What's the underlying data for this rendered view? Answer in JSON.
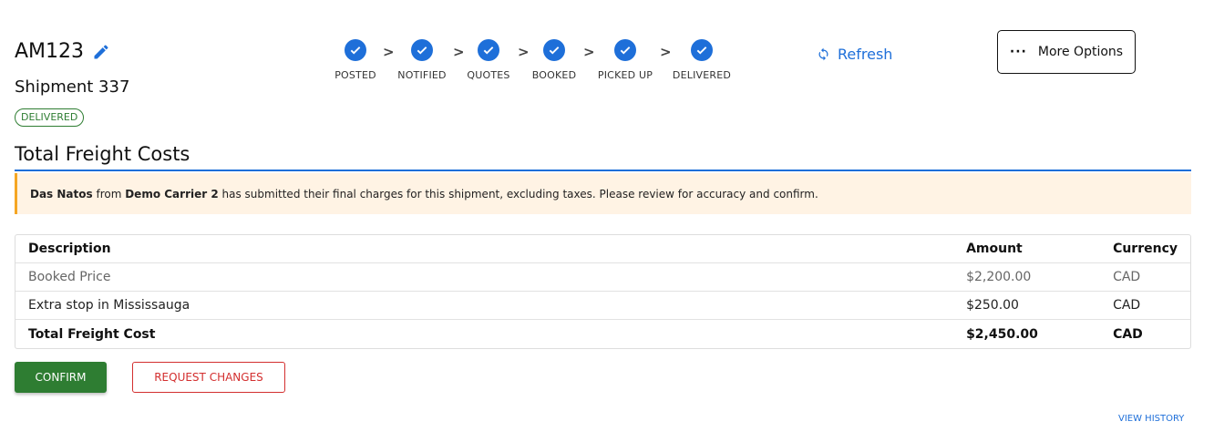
{
  "header": {
    "shipment_code": "AM123",
    "shipment_name": "Shipment 337",
    "status": "DELIVERED"
  },
  "steps": [
    {
      "label": "POSTED"
    },
    {
      "label": "NOTIFIED"
    },
    {
      "label": "QUOTES"
    },
    {
      "label": "BOOKED"
    },
    {
      "label": "PICKED UP"
    },
    {
      "label": "DELIVERED"
    }
  ],
  "step_separator": ">",
  "actions": {
    "refresh_label": "Refresh",
    "more_options_label": "More Options",
    "more_options_dots": "···"
  },
  "section": {
    "title": "Total Freight Costs"
  },
  "notice": {
    "person": "Das Natos",
    "from_text": " from ",
    "carrier": "Demo Carrier 2",
    "message": " has submitted their final charges for this shipment, excluding taxes. Please review for accuracy and confirm."
  },
  "table": {
    "headers": {
      "description": "Description",
      "amount": "Amount",
      "currency": "Currency"
    },
    "rows": [
      {
        "description": "Booked Price",
        "amount": "$2,200.00",
        "currency": "CAD"
      },
      {
        "description": "Extra stop in Mississauga",
        "amount": "$250.00",
        "currency": "CAD"
      },
      {
        "description": "Total Freight Cost",
        "amount": "$2,450.00",
        "currency": "CAD"
      }
    ]
  },
  "buttons": {
    "confirm": "CONFIRM",
    "request_changes": "REQUEST CHANGES"
  },
  "footer": {
    "view_history": "VIEW HISTORY"
  },
  "colors": {
    "accent": "#1e6fd9",
    "success": "#2e7d32",
    "danger": "#d32f2f",
    "notice_bg": "#fff3e4",
    "notice_border": "#f5a623"
  }
}
